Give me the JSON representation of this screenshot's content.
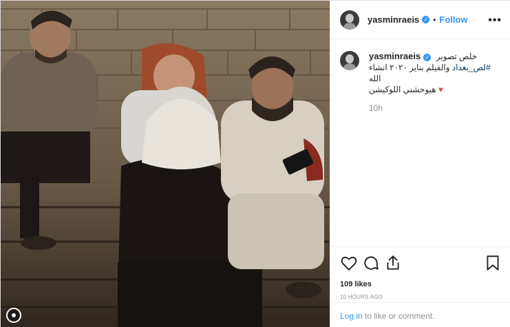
{
  "post": {
    "username": "yasminraeis",
    "verified_mark": "✓",
    "separator": "•",
    "follow_label": "Follow",
    "more_label": "•••"
  },
  "caption": {
    "username": "yasminraeis",
    "line1": "خلص تصوير",
    "hashtag": "#لص_بغداد",
    "line2_rest": " والفيلم بناير ٢٠٢٠ انشاء الله",
    "line3": "هيوحشني اللوكيشن",
    "heart": "♥",
    "time": "10h"
  },
  "actions": {
    "icons": [
      "heart-outline-icon",
      "comment-icon",
      "share-icon",
      "bookmark-icon"
    ],
    "likes": "109 likes",
    "posted_ago": "10 HOURS AGO"
  },
  "login": {
    "link": "Log in",
    "rest": " to like or comment."
  },
  "colors": {
    "link_blue": "#3897f0",
    "verified_blue": "#3897f0",
    "heart_red": "#ed4956",
    "muted": "#8e8e8e"
  }
}
